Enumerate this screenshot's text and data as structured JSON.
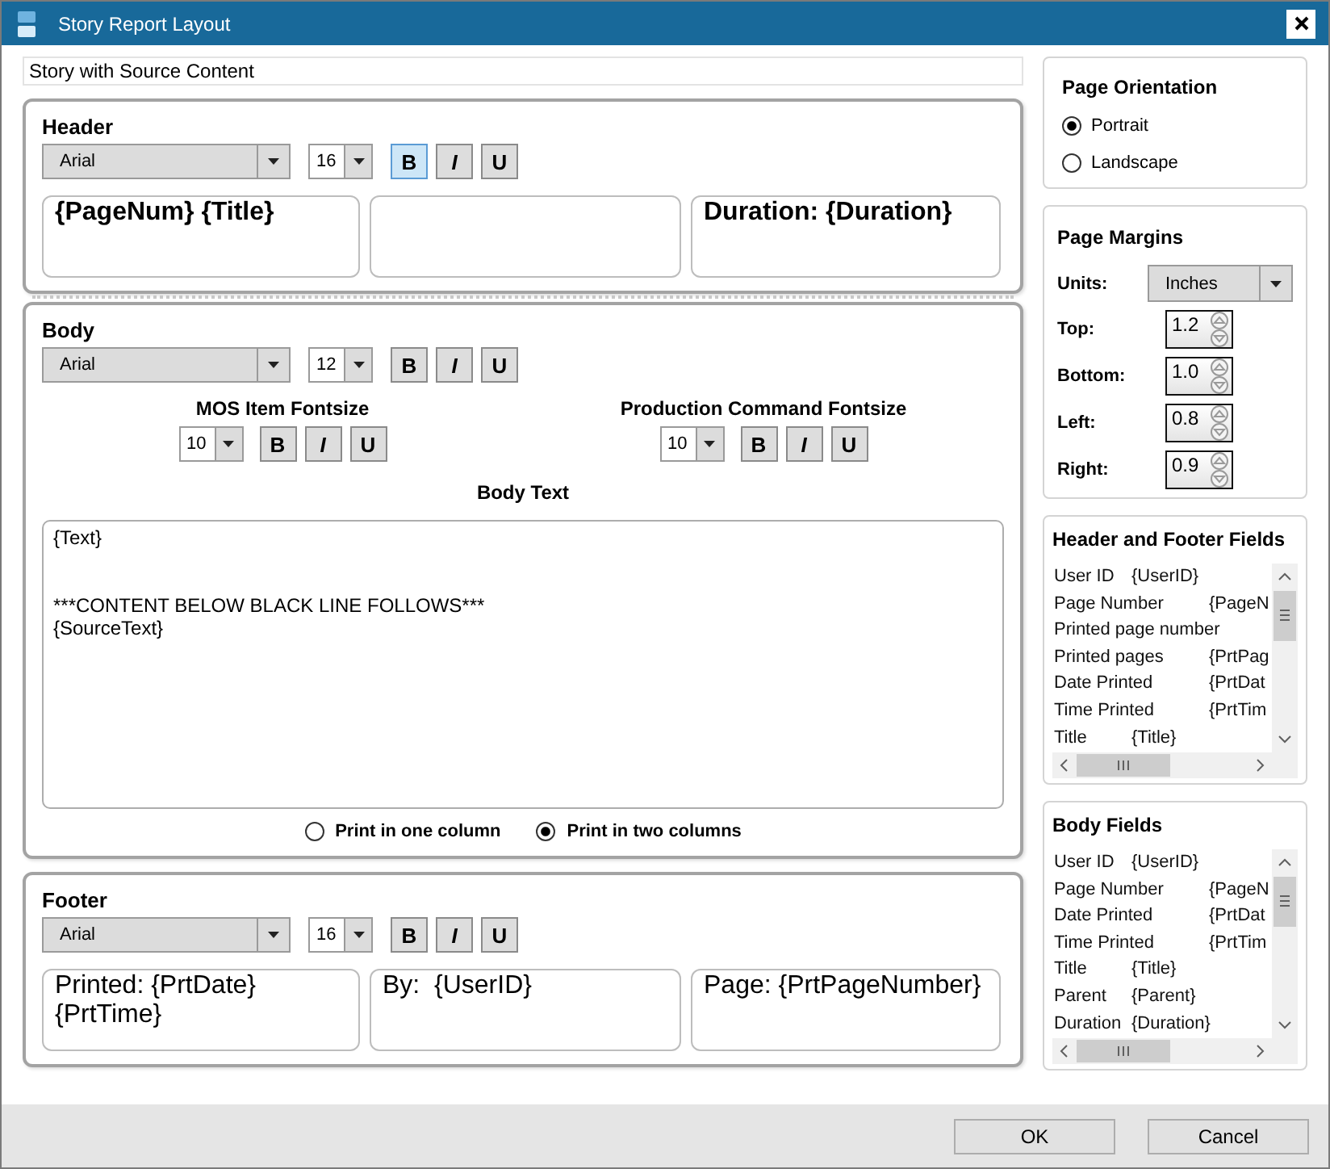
{
  "window": {
    "title": "Story Report Layout"
  },
  "name_field": {
    "value": "Story with Source Content"
  },
  "sections": [
    {
      "kind": "header",
      "title": "Header",
      "format": {
        "font": "Arial",
        "size": "16",
        "buttons": [
          {
            "label": "B",
            "selected": true
          },
          {
            "label": "I",
            "selected": false
          },
          {
            "label": "U",
            "selected": false
          }
        ]
      },
      "cells": [
        {
          "text": "{PageNum} {Title}"
        },
        {},
        {
          "text": "Duration: {Duration}"
        }
      ]
    },
    {
      "kind": "body",
      "title": "Body",
      "format": {
        "font": "Arial",
        "size": "12",
        "buttons": [
          {
            "label": "B",
            "selected": false
          },
          {
            "label": "I",
            "selected": false
          },
          {
            "label": "U",
            "selected": false
          }
        ]
      },
      "sub_formats": [
        {
          "title": "MOS Item Fontsize",
          "size": "10",
          "buttons": [
            {
              "label": "B",
              "selected": false
            },
            {
              "label": "I",
              "selected": false
            },
            {
              "label": "U",
              "selected": false
            }
          ]
        },
        {
          "title": "Production Command Fontsize",
          "size": "10",
          "buttons": [
            {
              "label": "B",
              "selected": false
            },
            {
              "label": "I",
              "selected": false
            },
            {
              "label": "U",
              "selected": false
            }
          ]
        }
      ],
      "body_text": {
        "label": "Body Text",
        "value": "{Text}\n\n\n***CONTENT BELOW BLACK LINE FOLLOWS***\n{SourceText}"
      },
      "column_options": [
        {
          "label": "Print in one column",
          "selected": false
        },
        {
          "label": "Print in two columns",
          "selected": true
        }
      ]
    },
    {
      "kind": "footer",
      "title": "Footer",
      "format": {
        "font": "Arial",
        "size": "16",
        "buttons": [
          {
            "label": "B",
            "selected": false
          },
          {
            "label": "I",
            "selected": false
          },
          {
            "label": "U",
            "selected": false
          }
        ]
      },
      "cells": [
        {
          "text": "Printed: {PrtDate} {PrtTime}"
        },
        {
          "text": "By:  {UserID}"
        },
        {
          "text": "Page: {PrtPageNumber}"
        }
      ]
    }
  ],
  "orientation": {
    "title": "Page Orientation",
    "options": [
      {
        "label": "Portrait",
        "selected": true
      },
      {
        "label": "Landscape",
        "selected": false
      }
    ]
  },
  "margins": {
    "title": "Page Margins",
    "units": {
      "label": "Units:",
      "value": "Inches"
    },
    "fields": [
      {
        "label": "Top:",
        "value": "1.2"
      },
      {
        "label": "Bottom:",
        "value": "1.0"
      },
      {
        "label": "Left:",
        "value": "0.8"
      },
      {
        "label": "Right:",
        "value": "0.9"
      }
    ]
  },
  "field_lists": [
    {
      "title": "Header and Footer Fields",
      "items": [
        {
          "label": "User ID",
          "value": "{UserID}"
        },
        {
          "label": "Page Number",
          "value": "{PageN"
        },
        {
          "label": "Printed page number"
        },
        {
          "label": "Printed pages",
          "value": "{PrtPag"
        },
        {
          "label": "Date Printed",
          "value": "{PrtDat"
        },
        {
          "label": "Time Printed",
          "value": "{PrtTim"
        },
        {
          "label": "Title",
          "value": "{Title}"
        }
      ]
    },
    {
      "title": "Body Fields",
      "items": [
        {
          "label": "User ID",
          "value": "{UserID}"
        },
        {
          "label": "Page Number",
          "value": "{PageN"
        },
        {
          "label": "Date Printed",
          "value": "{PrtDat"
        },
        {
          "label": "Time Printed",
          "value": "{PrtTim"
        },
        {
          "label": "Title",
          "value": "{Title}"
        },
        {
          "label": "Parent",
          "value": "{Parent}"
        },
        {
          "label": "Duration",
          "value": "{Duration}"
        }
      ]
    }
  ],
  "buttons": [
    {
      "label": "OK"
    },
    {
      "label": "Cancel"
    }
  ]
}
